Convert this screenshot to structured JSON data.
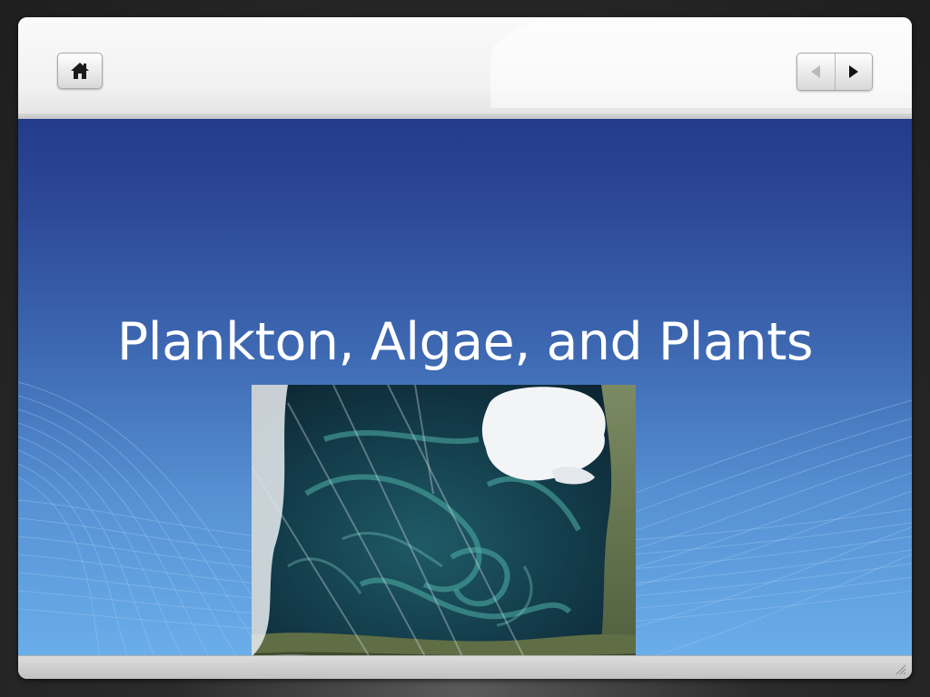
{
  "slide": {
    "title": "Plankton, Algae, and Plants",
    "image_description_icon": "satellite-image"
  },
  "toolbar": {
    "home_icon": "home-icon",
    "previous_icon": "previous-arrow-icon",
    "next_icon": "next-arrow-icon"
  },
  "colors": {
    "slide_top": "#233b8a",
    "slide_bottom": "#6aaeea",
    "toolbar": "#f1f1f1",
    "title_text": "#ffffff"
  }
}
